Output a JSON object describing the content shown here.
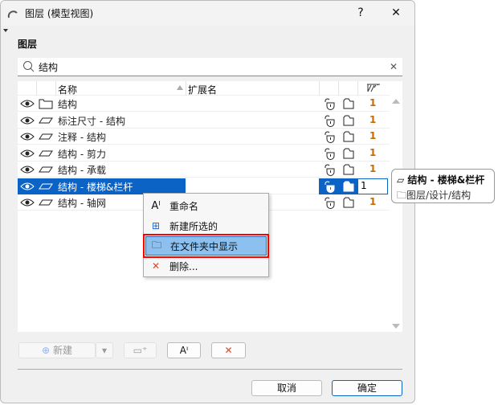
{
  "window": {
    "title": "图层 (模型视图)",
    "help": "?",
    "close": "✕"
  },
  "section_title": "图层",
  "search": {
    "value": "结构"
  },
  "columns": {
    "name": "名称",
    "extension": "扩展名"
  },
  "rows": [
    {
      "name": "结构",
      "type": "folder",
      "pen": "1"
    },
    {
      "name": "标注尺寸 - 结构",
      "type": "layer",
      "pen": "1"
    },
    {
      "name": "注释 - 结构",
      "type": "layer",
      "pen": "1"
    },
    {
      "name": "结构 - 剪力",
      "type": "layer",
      "pen": "1"
    },
    {
      "name": "结构 - 承载",
      "type": "layer",
      "pen": "1"
    },
    {
      "name": "结构 - 楼梯&栏杆",
      "type": "layer",
      "pen": "1",
      "selected": true
    },
    {
      "name": "结构 - 轴网",
      "type": "layer",
      "pen": "1"
    }
  ],
  "tooltip": {
    "name": "结构 - 楼梯&栏杆",
    "path": "图层/设计/结构"
  },
  "context_menu": [
    {
      "label": "重命名",
      "icon": "rename-icon"
    },
    {
      "label": "新建所选的",
      "icon": "new-selected-icon"
    },
    {
      "label": "在文件夹中显示",
      "icon": "show-in-folder-icon",
      "highlighted": true
    },
    {
      "label": "删除...",
      "icon": "delete-icon"
    }
  ],
  "toolbar": {
    "new_label": "新建"
  },
  "footer": {
    "cancel": "取消",
    "ok": "确定"
  },
  "colors": {
    "selection": "#0b63c5",
    "highlight": "#8cc0ee",
    "outline": "#ff0000",
    "pen": "#c76a00"
  }
}
